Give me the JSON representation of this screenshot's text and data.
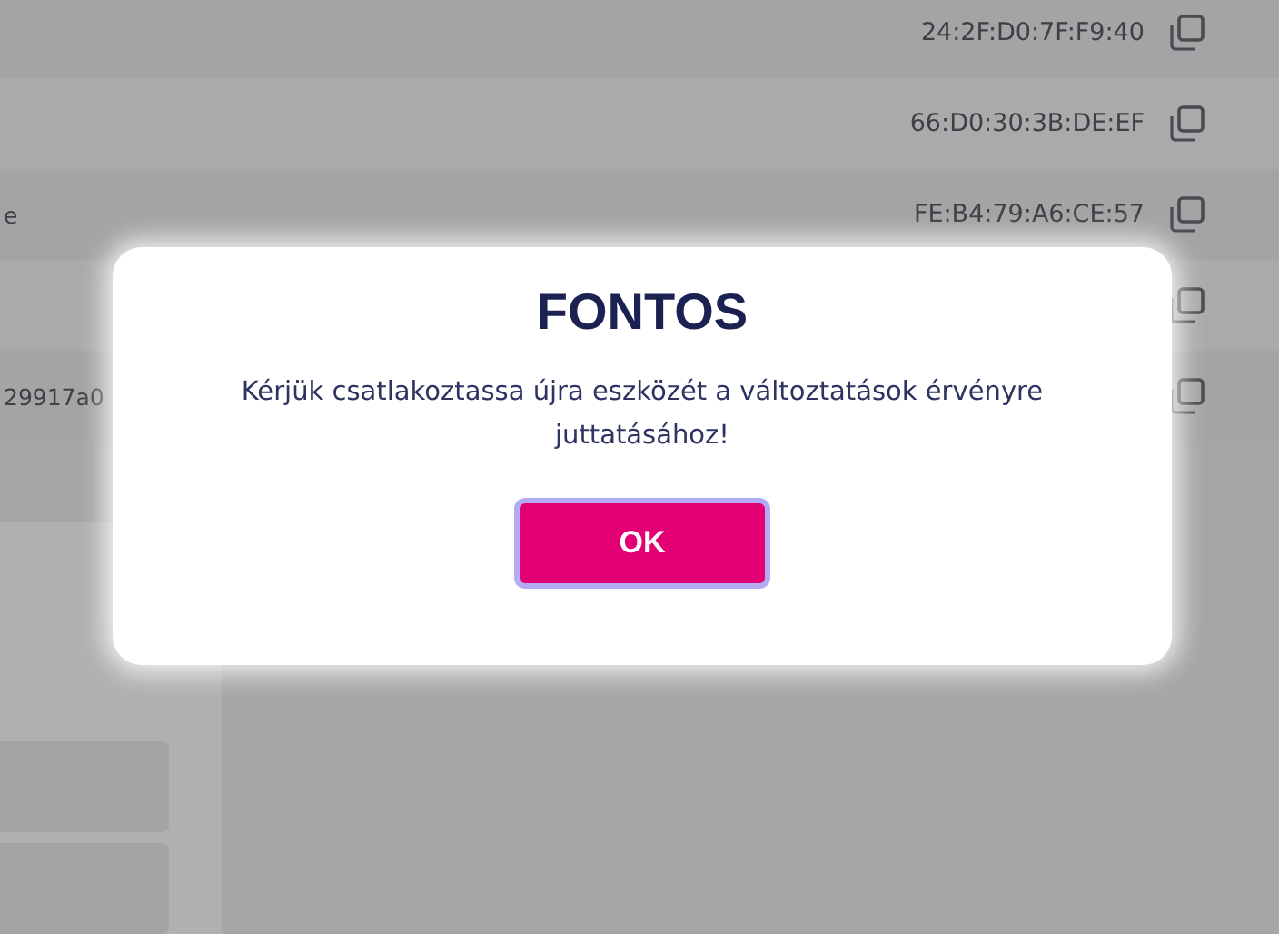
{
  "devices": [
    {
      "kind": "device",
      "mac": "24:2F:D0:7F:F9:40"
    },
    {
      "kind": "device",
      "mac": "66:D0:30:3B:DE:EF"
    },
    {
      "kind": "device",
      "name": "e",
      "mac": "FE:B4:79:A6:CE:57"
    },
    {
      "kind": "device"
    },
    {
      "kind": "device",
      "name": "29917a0"
    }
  ],
  "dialog": {
    "title": "FONTOS",
    "message": "Kérjük csatlakoztassa újra eszközét a változtatások érvényre juttatásához!",
    "button": "OK"
  }
}
